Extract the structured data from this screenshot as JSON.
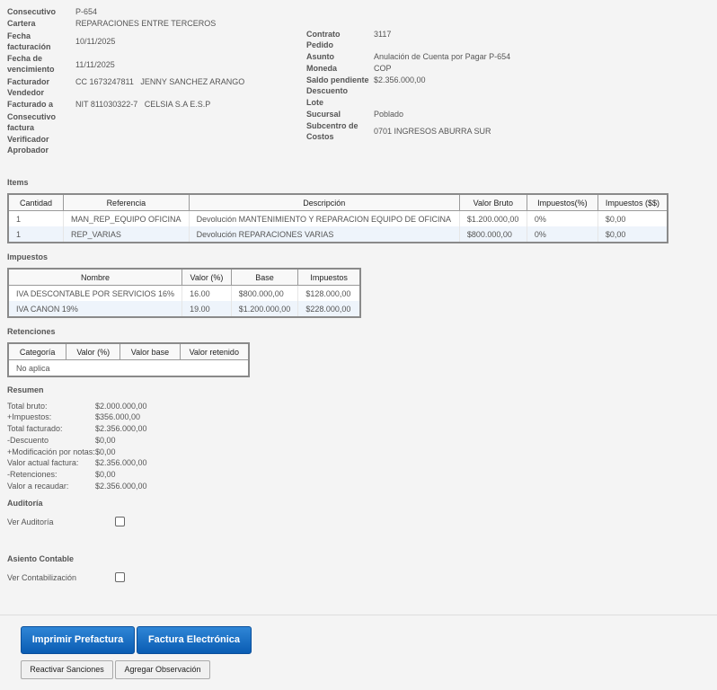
{
  "header_left": [
    {
      "label": "Consecutivo",
      "value": "P-654"
    },
    {
      "label": "Cartera",
      "value": "REPARACIONES ENTRE TERCEROS"
    },
    {
      "label": "Fecha facturación",
      "value": "10/11/2025"
    },
    {
      "label": "Fecha de vencimiento",
      "value": "11/11/2025"
    },
    {
      "label": "Facturador",
      "value": "CC 1673247811   JENNY SANCHEZ ARANGO"
    },
    {
      "label": "Vendedor",
      "value": ""
    },
    {
      "label": "Facturado a",
      "value": "NIT 811030322-7   CELSIA S.A E.S.P"
    },
    {
      "label": "Consecutivo factura",
      "value": ""
    },
    {
      "label": "Verificador",
      "value": ""
    },
    {
      "label": "Aprobador",
      "value": ""
    }
  ],
  "header_right": [
    {
      "label": "Contrato",
      "value": "3117"
    },
    {
      "label": "Pedido",
      "value": ""
    },
    {
      "label": "Asunto",
      "value": "Anulación de Cuenta por Pagar P-654"
    },
    {
      "label": "Moneda",
      "value": "COP"
    },
    {
      "label": "Saldo pendiente",
      "value": "$2.356.000,00"
    },
    {
      "label": "Descuento",
      "value": ""
    },
    {
      "label": "Lote",
      "value": ""
    },
    {
      "label": "Sucursal",
      "value": "Poblado"
    },
    {
      "label": "Subcentro de Costos",
      "value": "0701 INGRESOS ABURRA SUR"
    }
  ],
  "items": {
    "title": "Items",
    "columns": [
      "Cantidad",
      "Referencia",
      "Descripción",
      "Valor Bruto",
      "Impuestos(%)",
      "Impuestos ($$)"
    ],
    "rows": [
      [
        "1",
        "MAN_REP_EQUIPO OFICINA",
        "Devolución MANTENIMIENTO Y REPARACION EQUIPO DE OFICINA",
        "$1.200.000,00",
        "0%",
        "$0,00"
      ],
      [
        "1",
        "REP_VARIAS",
        "Devolución REPARACIONES VARIAS",
        "$800.000,00",
        "0%",
        "$0,00"
      ]
    ]
  },
  "impuestos": {
    "title": "Impuestos",
    "columns": [
      "Nombre",
      "Valor (%)",
      "Base",
      "Impuestos"
    ],
    "rows": [
      [
        "IVA DESCONTABLE POR SERVICIOS 16%",
        "16.00",
        "$800.000,00",
        "$128.000,00"
      ],
      [
        "IVA CANON 19%",
        "19.00",
        "$1.200.000,00",
        "$228.000,00"
      ]
    ]
  },
  "retenciones": {
    "title": "Retenciones",
    "columns": [
      "Categoría",
      "Valor (%)",
      "Valor base",
      "Valor retenido"
    ],
    "empty": "No aplica"
  },
  "resumen": {
    "title": "Resumen",
    "rows": [
      {
        "label": "Total bruto:",
        "value": "$2.000.000,00"
      },
      {
        "label": "+Impuestos:",
        "value": "$356.000,00"
      },
      {
        "label": "Total facturado:",
        "value": "$2.356.000,00"
      },
      {
        "label": "-Descuento",
        "value": "$0,00"
      },
      {
        "label": "+Modificación por notas:",
        "value": "$0,00"
      },
      {
        "label": "Valor actual factura:",
        "value": "$2.356.000,00"
      },
      {
        "label": "-Retenciones:",
        "value": "$0,00"
      },
      {
        "label": "Valor a recaudar:",
        "value": "$2.356.000,00"
      }
    ]
  },
  "auditoria": {
    "title": "Auditoría",
    "check_label": "Ver Auditoría",
    "checked": false
  },
  "asiento": {
    "title": "Asiento Contable",
    "check_label": "Ver Contabilización",
    "checked": false
  },
  "buttons": {
    "imprimir": "Imprimir Prefactura",
    "factura": "Factura Electrónica",
    "reactivar": "Reactivar Sanciones",
    "observacion": "Agregar Observación"
  },
  "colors": {
    "primary_button": "#0a5cb3",
    "row_alt": "#eef4fb",
    "border": "#8a8a8a"
  }
}
